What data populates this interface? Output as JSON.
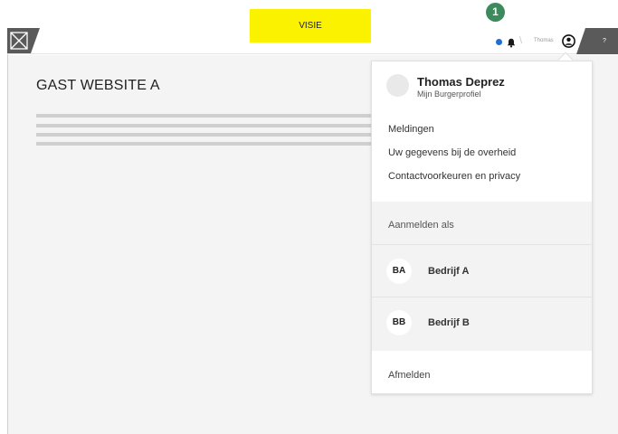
{
  "badge": {
    "label": "VISIE"
  },
  "step_marker": "1",
  "header": {
    "user_name": "Thomas",
    "help_label": "?"
  },
  "page": {
    "title": "GAST WEBSITE A"
  },
  "dropdown": {
    "profile_name": "Thomas Deprez",
    "profile_sub": "Mijn Burgerprofiel",
    "links": [
      {
        "label": "Meldingen"
      },
      {
        "label": "Uw gegevens bij de overheid"
      },
      {
        "label": "Contactvoorkeuren en privacy"
      }
    ],
    "login_as_label": "Aanmelden als",
    "organizations": [
      {
        "initials": "BA",
        "name": "Bedrijf A"
      },
      {
        "initials": "BB",
        "name": "Bedrijf B"
      }
    ],
    "logout_label": "Afmelden"
  },
  "colors": {
    "badge": "#fbf200",
    "step": "#3d8a5c",
    "notification_dot": "#1f6fd4",
    "header_dark": "#5a5a5a"
  },
  "icons": {
    "logo": "image-placeholder-icon",
    "notification": "bell-icon",
    "user": "user-circle-icon"
  }
}
